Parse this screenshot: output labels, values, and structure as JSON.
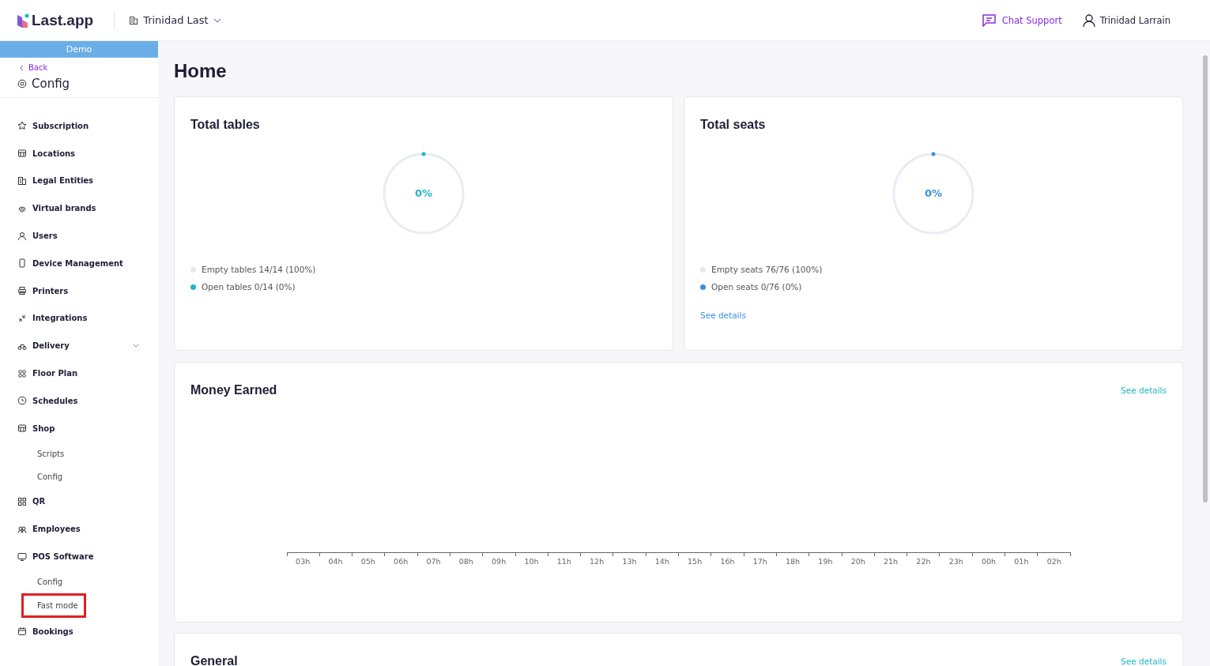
{
  "header": {
    "logo": "Last.app",
    "location": "Trinidad Last",
    "chat_support": "Chat Support",
    "user": "Trinidad Larrain"
  },
  "sidebar": {
    "banner": "Demo",
    "back": "Back",
    "title": "Config",
    "items": [
      {
        "label": "Subscription"
      },
      {
        "label": "Locations"
      },
      {
        "label": "Legal Entities"
      },
      {
        "label": "Virtual brands"
      },
      {
        "label": "Users"
      },
      {
        "label": "Device Management"
      },
      {
        "label": "Printers"
      },
      {
        "label": "Integrations"
      },
      {
        "label": "Delivery",
        "expanded": false
      },
      {
        "label": "Floor Plan"
      },
      {
        "label": "Schedules"
      },
      {
        "label": "Shop",
        "expanded": true,
        "children": [
          {
            "label": "Scripts",
            "highlighted": false
          },
          {
            "label": "Config",
            "highlighted": false
          }
        ]
      },
      {
        "label": "QR"
      },
      {
        "label": "Employees"
      },
      {
        "label": "POS Software",
        "expanded": true,
        "children": [
          {
            "label": "Config",
            "highlighted": false
          },
          {
            "label": "Fast mode",
            "highlighted": true
          }
        ]
      },
      {
        "label": "Bookings"
      }
    ]
  },
  "page_title": "Home",
  "stat_cards": [
    {
      "title": "Total tables",
      "percent": "0%",
      "level": 0,
      "color": "#1bb8c8",
      "legend": [
        {
          "text": "Empty tables 14/14 (100%)",
          "color": "#e8e8f0"
        },
        {
          "text": "Open tables 0/14 (0%)",
          "color": "#1bb8c8"
        }
      ]
    },
    {
      "title": "Total seats",
      "percent": "0%",
      "level": 0,
      "color": "#3a8ee6",
      "legend": [
        {
          "text": "Empty seats 76/76 (100%)",
          "color": "#e8e8f0"
        },
        {
          "text": "Open seats 0/76 (0%)",
          "color": "#3a8ee6"
        }
      ],
      "link": "See details"
    }
  ],
  "money_card": {
    "title": "Money Earned",
    "link": "See details",
    "hours": [
      "03h",
      "04h",
      "05h",
      "06h",
      "07h",
      "08h",
      "09h",
      "10h",
      "11h",
      "12h",
      "13h",
      "14h",
      "15h",
      "16h",
      "17h",
      "18h",
      "19h",
      "20h",
      "21h",
      "22h",
      "23h",
      "00h",
      "01h",
      "02h"
    ]
  },
  "general_card": {
    "title": "General",
    "link": "See details"
  }
}
